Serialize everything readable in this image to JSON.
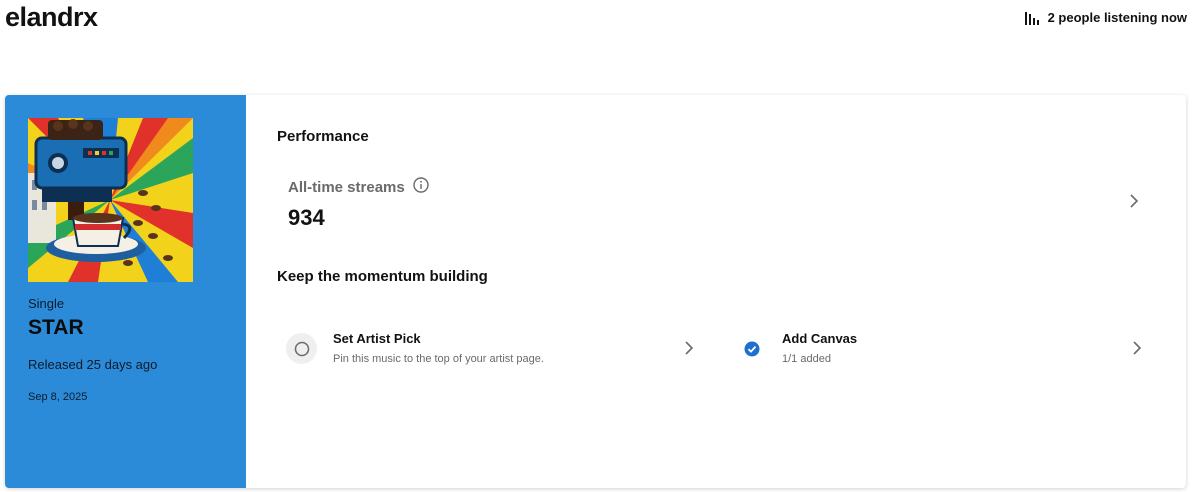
{
  "header": {
    "artist_name": "elandrx",
    "listening_text": "2 people listening now",
    "listening_icon": "bar-chart-icon"
  },
  "release": {
    "type": "Single",
    "title": "STAR",
    "released_ago": "Released 25 days ago",
    "date": "Sep 8, 2025",
    "panel_color": "#2b8bd8"
  },
  "performance": {
    "heading": "Performance",
    "streams_label": "All-time streams",
    "streams_value": "934",
    "info_icon": "info-icon"
  },
  "momentum": {
    "heading": "Keep the momentum building",
    "tasks": [
      {
        "title": "Set Artist Pick",
        "subtitle": "Pin this music to the top of your artist page.",
        "status": "incomplete"
      },
      {
        "title": "Add Canvas",
        "subtitle": "1/1 added",
        "status": "complete",
        "check_color": "#1f6fd1"
      }
    ]
  }
}
